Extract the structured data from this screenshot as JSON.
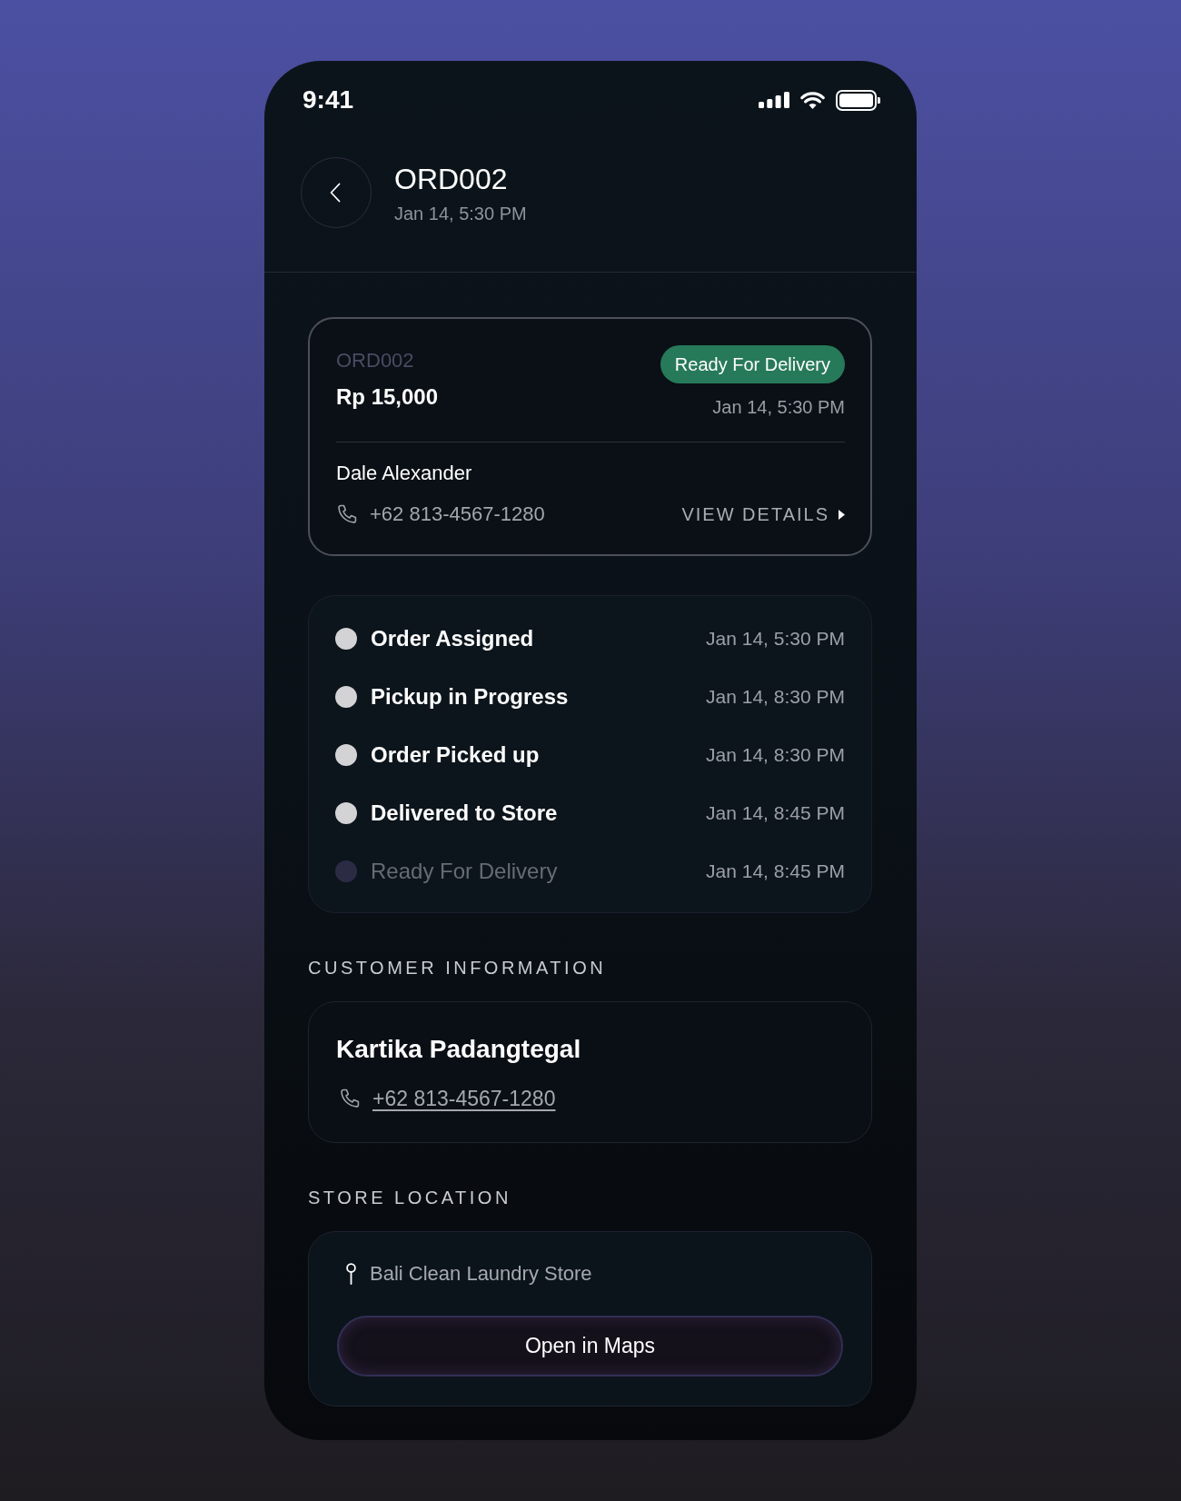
{
  "status_bar": {
    "time": "9:41"
  },
  "header": {
    "title": "ORD002",
    "subtitle": "Jan 14, 5:30 PM"
  },
  "order_card": {
    "order_id": "ORD002",
    "amount": "Rp 15,000",
    "status_badge": "Ready For Delivery",
    "date": "Jan 14, 5:30 PM",
    "courier_name": "Dale Alexander",
    "courier_phone": "+62 813-4567-1280",
    "view_details": "VIEW DETAILS"
  },
  "timeline": [
    {
      "label": "Order Assigned",
      "time": "Jan 14, 5:30 PM",
      "completed": true
    },
    {
      "label": "Pickup in Progress",
      "time": "Jan 14, 8:30 PM",
      "completed": true
    },
    {
      "label": "Order Picked up",
      "time": "Jan 14, 8:30 PM",
      "completed": true
    },
    {
      "label": "Delivered to Store",
      "time": "Jan 14, 8:45 PM",
      "completed": true
    },
    {
      "label": "Ready For Delivery",
      "time": "Jan 14, 8:45 PM",
      "completed": false
    }
  ],
  "customer_information": {
    "heading": "CUSTOMER INFORMATION",
    "name": "Kartika Padangtegal",
    "phone": "+62 813-4567-1280"
  },
  "store_location": {
    "heading": "STORE LOCATION",
    "store_name": "Bali Clean Laundry Store",
    "button": "Open in Maps"
  }
}
